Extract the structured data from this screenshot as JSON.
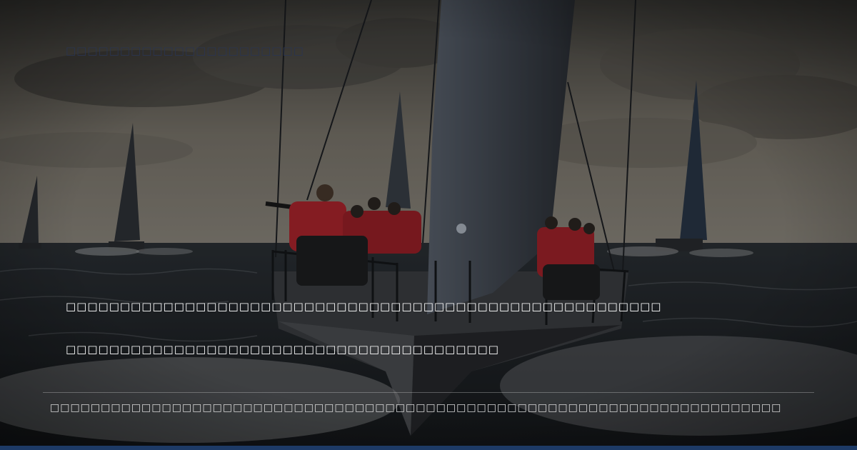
{
  "top_caption": "□□□□□□□□□□□□□□□□□□□□□□",
  "headline_line_1": "□□□□□□□□□□□□□□□□□□□□□□□□□□□□□□□□□□□□□□□□□□□□□□□□□□□□□□□",
  "headline_line_2": "□□□□□□□□□□□□□□□□□□□□□□□□□□□□□□□□□□□□□□□□",
  "footer_text": "□□□□□□□□□□□□□□□□□□□□□□□□□□□□□□□□□□□□□□□□□□□□□□□□□□□□□□□□□□□□□□□□□□□□□□□□",
  "colors": {
    "sky_top": "#4a4844",
    "sky_horizon": "#8a8478",
    "sea": "#1e2226",
    "spray": "#9a9c9e",
    "crew_jacket": "#b0262e",
    "bottom_bar": "#1d3a66"
  }
}
